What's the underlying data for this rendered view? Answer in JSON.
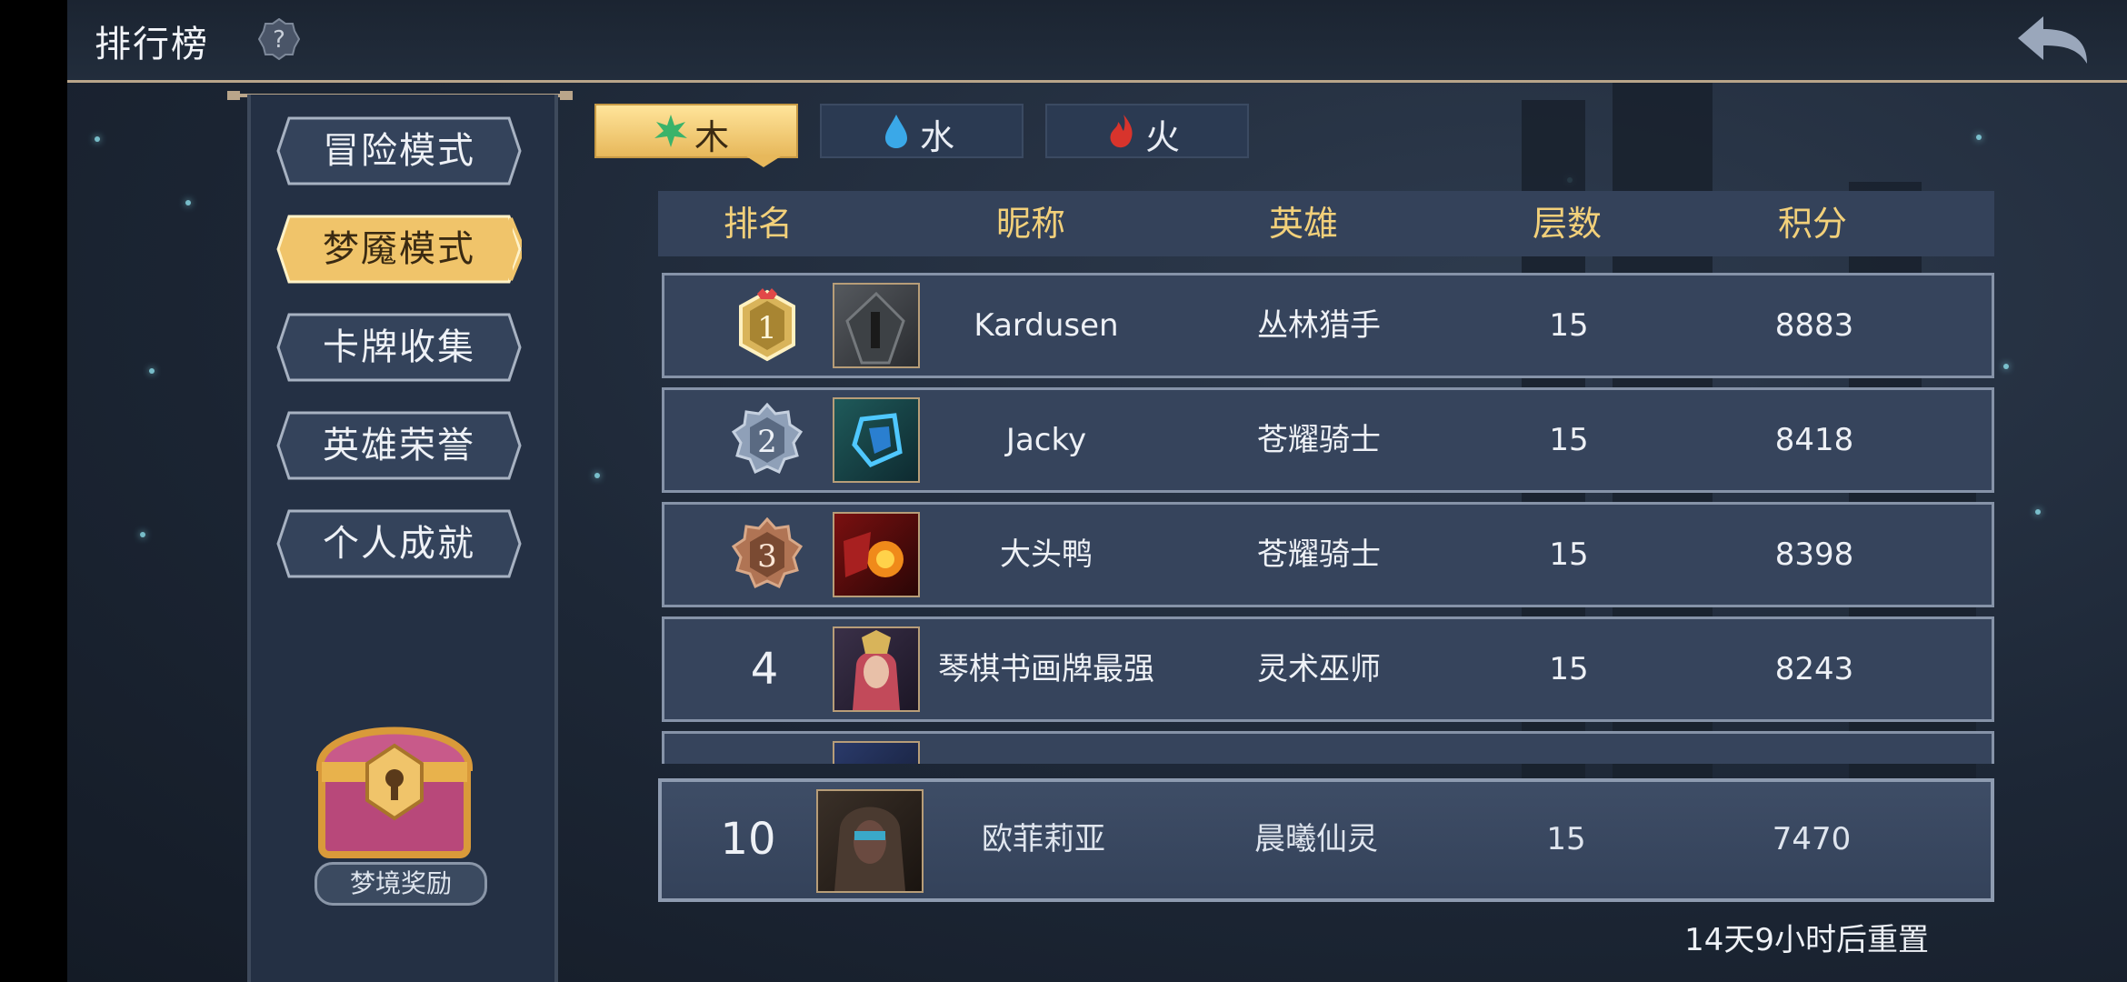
{
  "header": {
    "title": "排行榜"
  },
  "modes": [
    {
      "label": "冒险模式",
      "active": false
    },
    {
      "label": "梦魇模式",
      "active": true
    },
    {
      "label": "卡牌收集",
      "active": false
    },
    {
      "label": "英雄荣誉",
      "active": false
    },
    {
      "label": "个人成就",
      "active": false
    }
  ],
  "reward": {
    "label": "梦境奖励"
  },
  "tabs": [
    {
      "label": "木",
      "icon": "leaf-icon",
      "active": true
    },
    {
      "label": "水",
      "icon": "water-drop-icon",
      "active": false
    },
    {
      "label": "火",
      "icon": "fire-icon",
      "active": false
    }
  ],
  "table": {
    "headers": [
      "排名",
      "昵称",
      "英雄",
      "层数",
      "积分"
    ],
    "rows": [
      {
        "rank": "1",
        "name": "Kardusen",
        "hero": "丛林猎手",
        "floors": "15",
        "score": "8883"
      },
      {
        "rank": "2",
        "name": "Jacky",
        "hero": "苍耀骑士",
        "floors": "15",
        "score": "8418"
      },
      {
        "rank": "3",
        "name": "大头鸭",
        "hero": "苍耀骑士",
        "floors": "15",
        "score": "8398"
      },
      {
        "rank": "4",
        "name": "琴棋书画牌最强",
        "hero": "灵术巫师",
        "floors": "15",
        "score": "8243"
      }
    ]
  },
  "my_rank": {
    "rank": "10",
    "name": "欧菲莉亚",
    "hero": "晨曦仙灵",
    "floors": "15",
    "score": "7470"
  },
  "reset": {
    "text": "14天9小时后重置"
  },
  "colors": {
    "gold": "#f2d07a",
    "active_tab": "#e7b85b",
    "panel": "#36445c"
  }
}
